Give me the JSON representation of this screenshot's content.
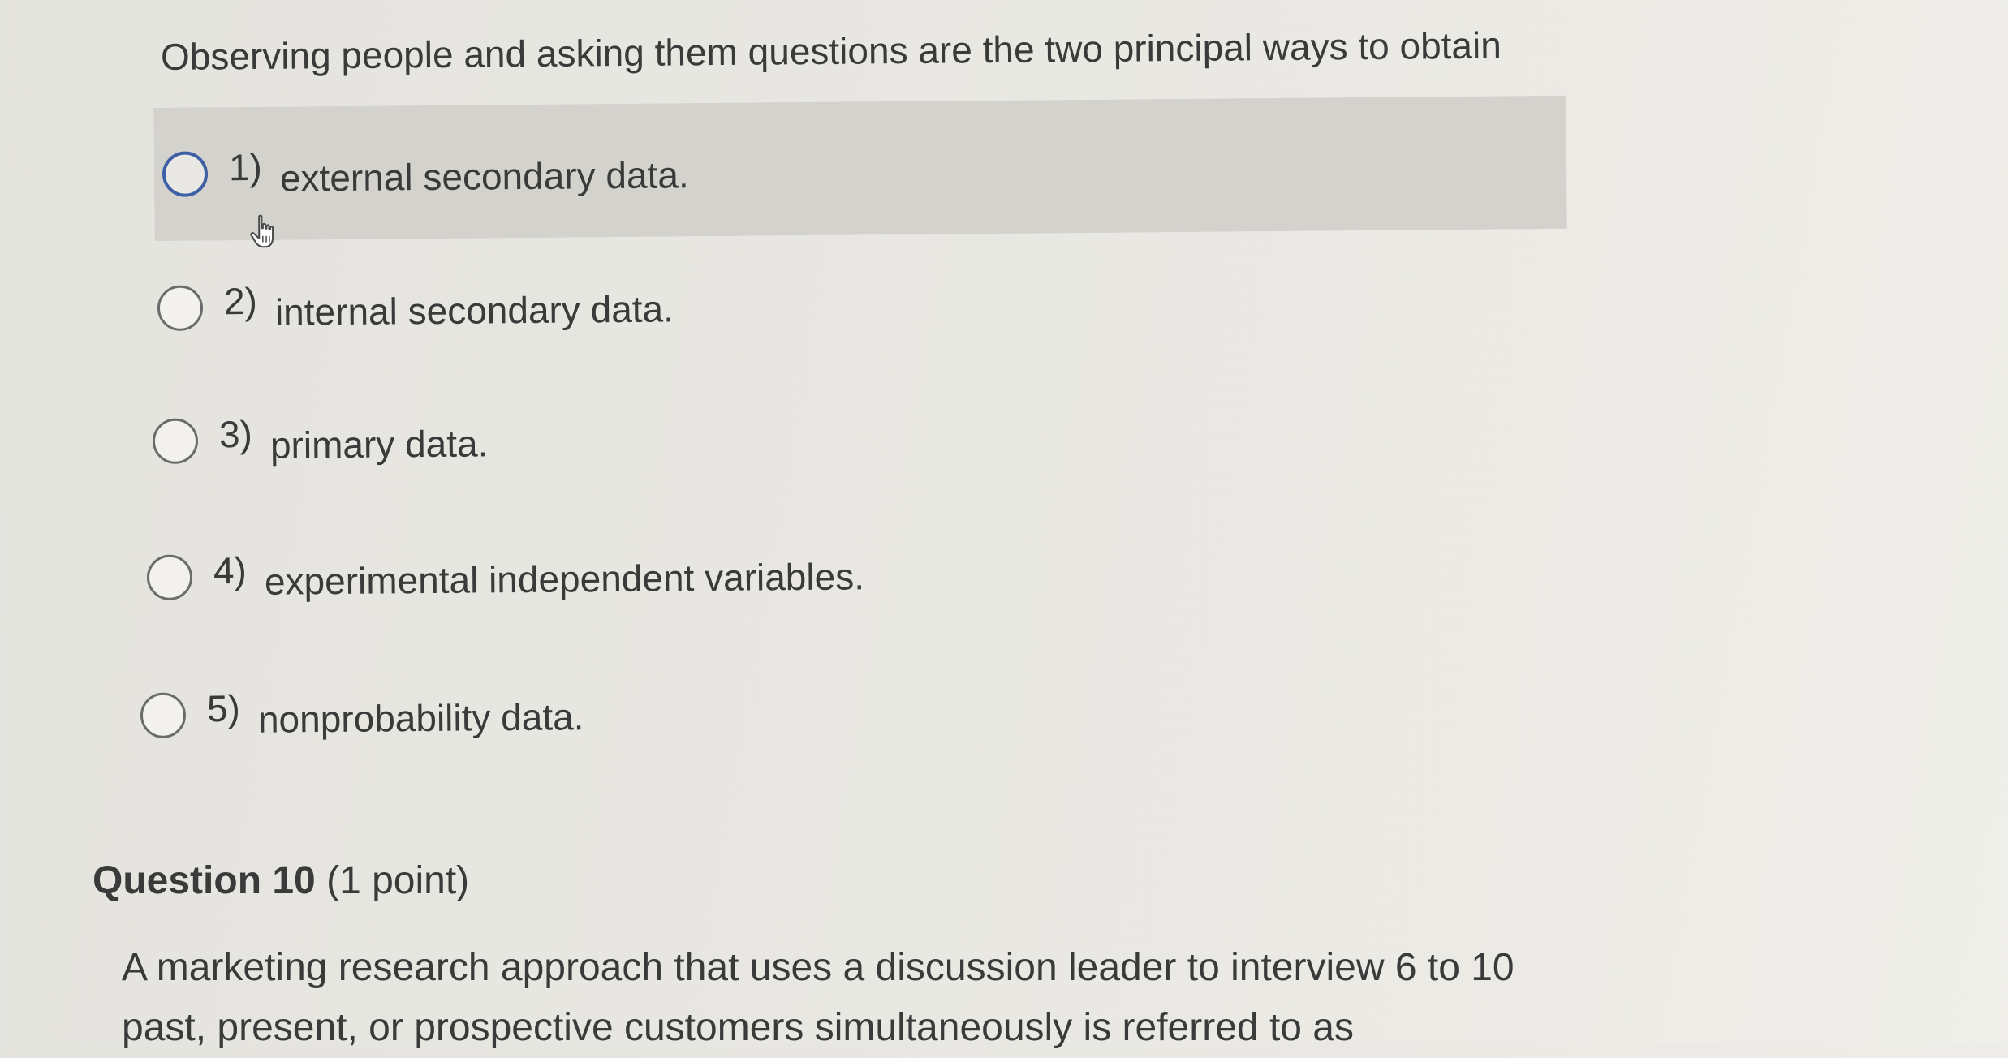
{
  "question9": {
    "text": "Observing people and asking them questions are the two principal ways to obtain",
    "options": [
      {
        "number": "1)",
        "label": "external secondary data."
      },
      {
        "number": "2)",
        "label": "internal secondary data."
      },
      {
        "number": "3)",
        "label": "primary data."
      },
      {
        "number": "4)",
        "label": "experimental independent variables."
      },
      {
        "number": "5)",
        "label": "nonprobability data."
      }
    ]
  },
  "question10": {
    "title": "Question 10",
    "points": "(1 point)",
    "text_line1": "A marketing research approach that uses a discussion leader to interview 6 to 10",
    "text_line2": "past, present, or prospective customers simultaneously is referred to as"
  },
  "colors": {
    "hover_background": "#d4d2cd",
    "radio_hover_border": "#3d5fa3",
    "text": "#3a3a3a"
  },
  "icons": {
    "cursor": "hand-pointer-icon"
  }
}
